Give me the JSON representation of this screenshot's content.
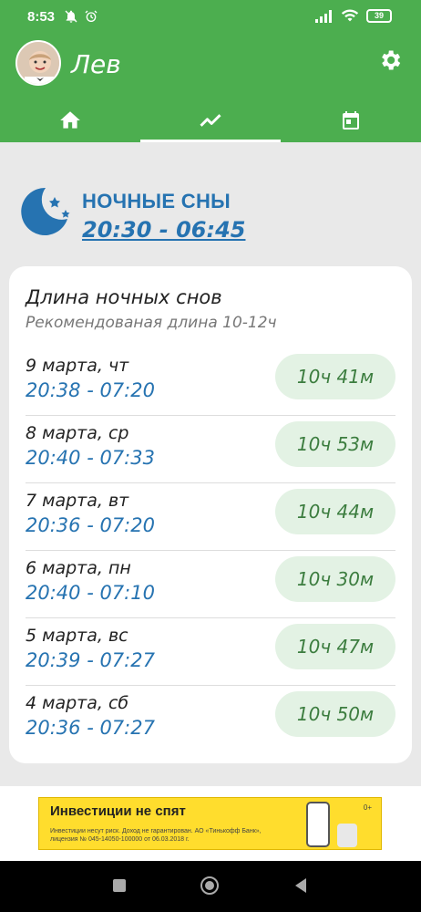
{
  "status_bar": {
    "time": "8:53",
    "battery": "39"
  },
  "header": {
    "username": "Лев",
    "tabs": [
      {
        "icon": "home-icon",
        "active": false
      },
      {
        "icon": "chart-line-icon",
        "active": true
      },
      {
        "icon": "calendar-icon",
        "active": false
      }
    ]
  },
  "nights": {
    "title": "НОЧНЫЕ СНЫ",
    "time_range": "20:30 - 06:45"
  },
  "card": {
    "title": "Длина ночных снов",
    "subtitle": "Рекомендованая длина 10-12ч",
    "rows": [
      {
        "date": "9 марта, чт",
        "range": "20:38 - 07:20",
        "duration": "10ч 41м"
      },
      {
        "date": "8 марта, ср",
        "range": "20:40 - 07:33",
        "duration": "10ч 53м"
      },
      {
        "date": "7 марта, вт",
        "range": "20:36 - 07:20",
        "duration": "10ч 44м"
      },
      {
        "date": "6 марта, пн",
        "range": "20:40 - 07:10",
        "duration": "10ч 30м"
      },
      {
        "date": "5 марта, вс",
        "range": "20:39 - 07:27",
        "duration": "10ч 47м"
      },
      {
        "date": "4 марта, сб",
        "range": "20:36 - 07:27",
        "duration": "10ч 50м"
      }
    ]
  },
  "ad": {
    "title": "Инвестиции не спят",
    "text": "Инвестиции несут риск. Доход не гарантирован. АО «Тинькофф Банк», лицензия № 045-14050-100000 от 06.03.2018 г.",
    "age": "0+"
  },
  "colors": {
    "brand_green": "#4cae4f",
    "accent_blue": "#2673b1",
    "pill_bg": "#e3f2e4",
    "pill_text": "#3c7d3f"
  }
}
